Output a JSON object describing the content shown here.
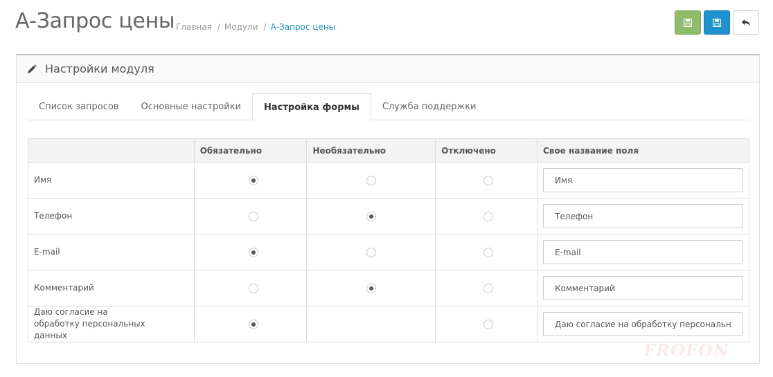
{
  "header": {
    "title": "А-Запрос цены",
    "breadcrumbs": [
      "Главная",
      "Модули",
      "А-Запрос цены"
    ],
    "buttons": {
      "save_stay_icon": "save-icon",
      "save_icon": "save-icon",
      "back_icon": "reply-icon"
    },
    "colors": {
      "success": "#8fbb6c",
      "primary": "#1e91cf"
    }
  },
  "panel": {
    "title": "Настройки модуля",
    "icon": "pencil-icon"
  },
  "tabs": [
    {
      "label": "Список запросов",
      "active": false
    },
    {
      "label": "Основные настройки",
      "active": false
    },
    {
      "label": "Настройка формы",
      "active": true
    },
    {
      "label": "Служба поддержки",
      "active": false
    }
  ],
  "table": {
    "headers": [
      "",
      "Обязательно",
      "Необязательно",
      "Отключено",
      "Свое название поля"
    ],
    "rows": [
      {
        "label": "Имя",
        "selected": "required",
        "has_optional": true,
        "input_value": "Имя"
      },
      {
        "label": "Телефон",
        "selected": "optional",
        "has_optional": true,
        "input_value": "Телефон"
      },
      {
        "label": "E-mail",
        "selected": "required",
        "has_optional": true,
        "input_value": "E-mail"
      },
      {
        "label": "Комментарий",
        "selected": "optional",
        "has_optional": true,
        "input_value": "Комментарий"
      },
      {
        "label": "Даю согласие на обработку персональных данных",
        "selected": "required",
        "has_optional": false,
        "input_value": "Даю согласие на обработку персональных данных"
      }
    ]
  },
  "watermark": "FROFON"
}
